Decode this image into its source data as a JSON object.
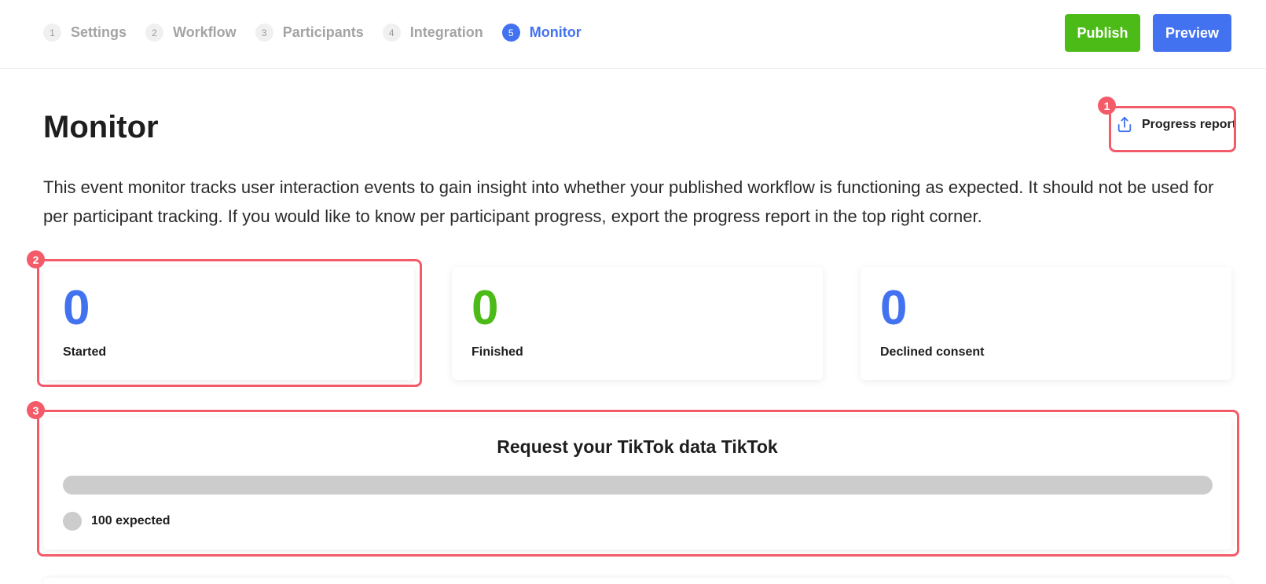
{
  "steps": [
    {
      "num": "1",
      "label": "Settings"
    },
    {
      "num": "2",
      "label": "Workflow"
    },
    {
      "num": "3",
      "label": "Participants"
    },
    {
      "num": "4",
      "label": "Integration"
    },
    {
      "num": "5",
      "label": "Monitor",
      "active": true
    }
  ],
  "header": {
    "publish_label": "Publish",
    "preview_label": "Preview"
  },
  "page": {
    "title": "Monitor",
    "progress_report_label": "Progress report",
    "progress_report_icon": "export-icon",
    "description": "This event monitor tracks user interaction events to gain insight into whether your published workflow is functioning as expected. It should not be used for per participant tracking. If you would like to know per participant progress, export the progress report in the top right corner."
  },
  "stats": [
    {
      "value": "0",
      "label": "Started",
      "color": "#4272ef"
    },
    {
      "value": "0",
      "label": "Finished",
      "color": "#4cbb17"
    },
    {
      "value": "0",
      "label": "Declined consent",
      "color": "#4272ef"
    }
  ],
  "flow": {
    "title": "Request your TikTok data TikTok",
    "progress_fraction": 0,
    "legend_label": "100 expected",
    "legend_color": "#cccccc"
  },
  "annotations": [
    {
      "number": "1"
    },
    {
      "number": "2"
    },
    {
      "number": "3"
    }
  ],
  "colors": {
    "accent": "#4272ef",
    "success": "#4cbb17",
    "highlight": "#f45b69"
  }
}
